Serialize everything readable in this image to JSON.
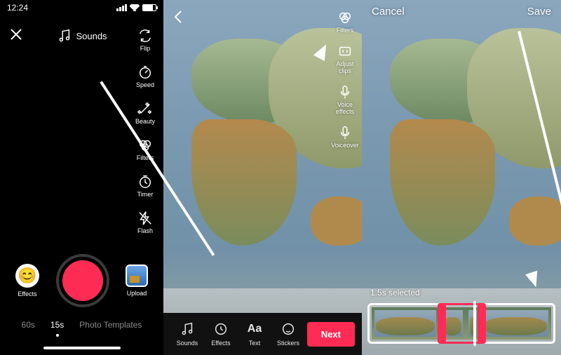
{
  "status": {
    "time": "12:24"
  },
  "panel1": {
    "sounds_label": "Sounds",
    "tools": {
      "flip": "Flip",
      "speed": "Speed",
      "beauty": "Beauty",
      "filters": "Filters",
      "timer": "Timer",
      "flash": "Flash"
    },
    "effects_label": "Effects",
    "upload_label": "Upload",
    "modes": {
      "m60": "60s",
      "m15": "15s",
      "templates": "Photo Templates"
    }
  },
  "panel2": {
    "tools": {
      "filters": "Filters",
      "adjust_clips": "Adjust clips",
      "voice_effects": "Voice\neffects",
      "voiceover": "Voiceover"
    },
    "toolbar": {
      "sounds": "Sounds",
      "effects": "Effects",
      "text": "Text",
      "text_glyph": "Aa",
      "stickers": "Stickers"
    },
    "next_label": "Next"
  },
  "panel3": {
    "cancel": "Cancel",
    "save": "Save",
    "selection_label": "1.5s selected"
  }
}
